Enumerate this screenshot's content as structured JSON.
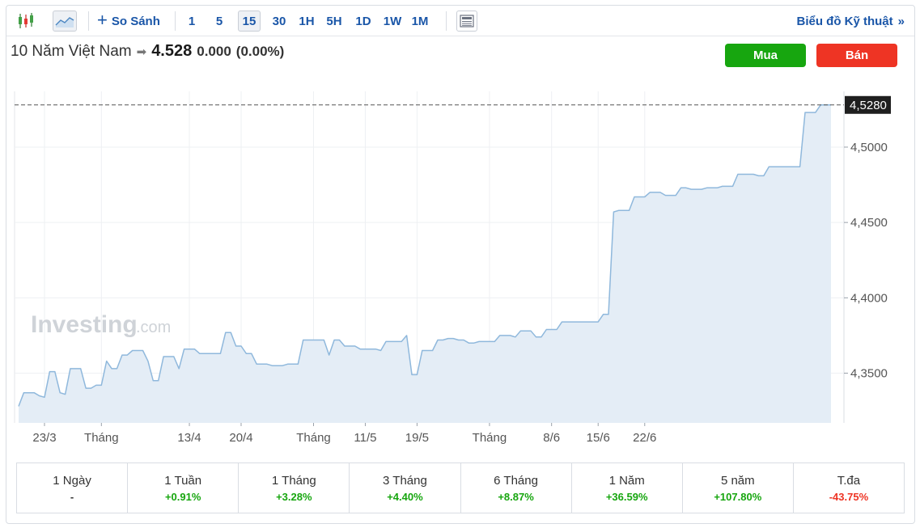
{
  "toolbar": {
    "compare_label": "So Sánh",
    "intervals": [
      "1",
      "5",
      "15",
      "30",
      "1H",
      "5H",
      "1D",
      "1W",
      "1M"
    ],
    "active_interval": "15",
    "technical_label": "Biểu đồ Kỹ thuật",
    "technical_chevron": "»"
  },
  "instrument": {
    "name": "10 Năm Việt Nam",
    "price": "4.528",
    "change": "0.000",
    "change_pct": "(0.00%)"
  },
  "actions": {
    "buy_label": "Mua",
    "sell_label": "Bán"
  },
  "watermark": {
    "brand": "Investing",
    "suffix": ".com"
  },
  "colors": {
    "line": "#8fb8dc",
    "fill": "#e4edf6",
    "positive": "#17a60f",
    "negative": "#ee3424",
    "accent": "#1a56a8"
  },
  "chart_data": {
    "type": "area",
    "y_axis_ticks": [
      "4,3500",
      "4,4000",
      "4,4500",
      "4,5000"
    ],
    "y_axis_tick_values": [
      4.35,
      4.4,
      4.45,
      4.5
    ],
    "ylim": [
      4.317,
      4.537
    ],
    "current_value_label": "4,5280",
    "current_value": 4.528,
    "x_axis_labels": [
      "23/3",
      "Tháng",
      "13/4",
      "20/4",
      "Tháng",
      "11/5",
      "19/5",
      "Tháng",
      "8/6",
      "15/6",
      "22/6"
    ],
    "x_axis_label_index": [
      5,
      16,
      33,
      43,
      57,
      67,
      77,
      91,
      103,
      112,
      121
    ],
    "grid": true,
    "values": [
      4.328,
      4.337,
      4.337,
      4.337,
      4.335,
      4.334,
      4.351,
      4.351,
      4.337,
      4.336,
      4.353,
      4.353,
      4.353,
      4.34,
      4.34,
      4.342,
      4.342,
      4.358,
      4.353,
      4.353,
      4.362,
      4.362,
      4.365,
      4.365,
      4.365,
      4.358,
      4.345,
      4.345,
      4.361,
      4.361,
      4.361,
      4.353,
      4.366,
      4.366,
      4.366,
      4.363,
      4.363,
      4.363,
      4.363,
      4.363,
      4.377,
      4.377,
      4.368,
      4.368,
      4.363,
      4.363,
      4.356,
      4.356,
      4.356,
      4.355,
      4.355,
      4.355,
      4.356,
      4.356,
      4.356,
      4.372,
      4.372,
      4.372,
      4.372,
      4.372,
      4.362,
      4.372,
      4.372,
      4.368,
      4.368,
      4.368,
      4.366,
      4.366,
      4.366,
      4.366,
      4.365,
      4.371,
      4.371,
      4.371,
      4.371,
      4.375,
      4.349,
      4.349,
      4.365,
      4.365,
      4.365,
      4.372,
      4.372,
      4.373,
      4.373,
      4.372,
      4.372,
      4.37,
      4.37,
      4.371,
      4.371,
      4.371,
      4.371,
      4.375,
      4.375,
      4.375,
      4.374,
      4.378,
      4.378,
      4.378,
      4.374,
      4.374,
      4.379,
      4.379,
      4.379,
      4.384,
      4.384,
      4.384,
      4.384,
      4.384,
      4.384,
      4.384,
      4.384,
      4.389,
      4.389,
      4.457,
      4.458,
      4.458,
      4.458,
      4.467,
      4.467,
      4.467,
      4.47,
      4.47,
      4.47,
      4.468,
      4.468,
      4.468,
      4.473,
      4.473,
      4.472,
      4.472,
      4.472,
      4.473,
      4.473,
      4.473,
      4.474,
      4.474,
      4.474,
      4.482,
      4.482,
      4.482,
      4.482,
      4.481,
      4.481,
      4.487,
      4.487,
      4.487,
      4.487,
      4.487,
      4.487,
      4.487,
      4.523,
      4.523,
      4.523,
      4.528,
      4.528,
      4.528
    ]
  },
  "performance": [
    {
      "label": "1 Ngày",
      "value": "-",
      "trend": "neutral"
    },
    {
      "label": "1 Tuần",
      "value": "+0.91%",
      "trend": "up"
    },
    {
      "label": "1 Tháng",
      "value": "+3.28%",
      "trend": "up"
    },
    {
      "label": "3 Tháng",
      "value": "+4.40%",
      "trend": "up"
    },
    {
      "label": "6 Tháng",
      "value": "+8.87%",
      "trend": "up"
    },
    {
      "label": "1 Năm",
      "value": "+36.59%",
      "trend": "up"
    },
    {
      "label": "5 năm",
      "value": "+107.80%",
      "trend": "up"
    },
    {
      "label": "T.đa",
      "value": "-43.75%",
      "trend": "down"
    }
  ]
}
